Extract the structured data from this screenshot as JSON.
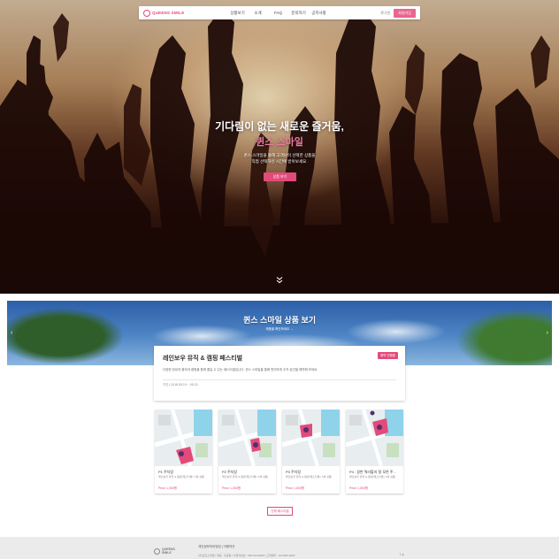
{
  "header": {
    "logo_text": "QUEENS SMILE",
    "menu": [
      "상품보기",
      "소개",
      "FAQ",
      "문의하기",
      "공지사항"
    ],
    "login_label": "로그인",
    "cta_label": "회원가입"
  },
  "hero": {
    "title": "기다림이 없는 새로운 즐거움,",
    "accent": "퀸스 스마일",
    "desc_line1": "퀸스 스마일을 통해 고객님이 선택한 상품을",
    "desc_line2": "직접 선택하신 시간에 받아보세요.",
    "button_label": "상품 보기",
    "scroll_icon": "chevron-double-down-icon"
  },
  "banner": {
    "title": "퀸스 스마일 상품 보기",
    "subtitle": "제품을 확인하세요 →",
    "prev_icon": "chevron-left-icon",
    "next_icon": "chevron-right-icon"
  },
  "festival": {
    "title": "레인보우 뮤직 & 캠핑 페스티벌",
    "badge": "예약 진행중",
    "desc": "다양한 장르의 음악과 캠핑을 함께 즐길 수 있는 페스티벌입니다. 퀸스 스마일을 통해 편리하게 주차 공간을 예약해 보세요.",
    "date": "기간 | 2018.05.19 ~ 05.20"
  },
  "lots": [
    {
      "name": "P1 주차장",
      "desc": "레인보우 뮤직 & 캠핑 페스티벌 / 1박 상품",
      "price": "Price 1,000원",
      "accent_color": "#e24a7a"
    },
    {
      "name": "P2 주차장",
      "desc": "레인보우 뮤직 & 캠핑 페스티벌 / 1박 상품",
      "price": "Price 1,000원",
      "accent_color": "#e24a7a"
    },
    {
      "name": "P3 주차장",
      "desc": "레인보우 뮤직 & 캠핑 페스티벌 / 1박 상품",
      "price": "Price 1,000원",
      "accent_color": "#e24a7a"
    },
    {
      "name": "P4 : 갈번 뭐라할지 잘 모른 주...",
      "desc": "레인보우 뮤직 & 캠핑 페스티벌 / 1박 상품",
      "price": "Price 1,000원",
      "accent_color": "#e24a7a"
    }
  ],
  "all_button_label": "전체 페스티벌",
  "footer": {
    "logo_text_1": "QUEENS",
    "logo_text_2": "SMILE",
    "links": "개인정보처리방침  |  이용약관",
    "info": "(주)퀸즈스마일  |  대표 : 홍길동  |  사업자번호 : 000-00-00000  |  고객센터 : 02-0000-0000",
    "social": "f  ◎"
  },
  "colors": {
    "brand": "#e24a7a",
    "brand_light": "#f07aa0"
  }
}
